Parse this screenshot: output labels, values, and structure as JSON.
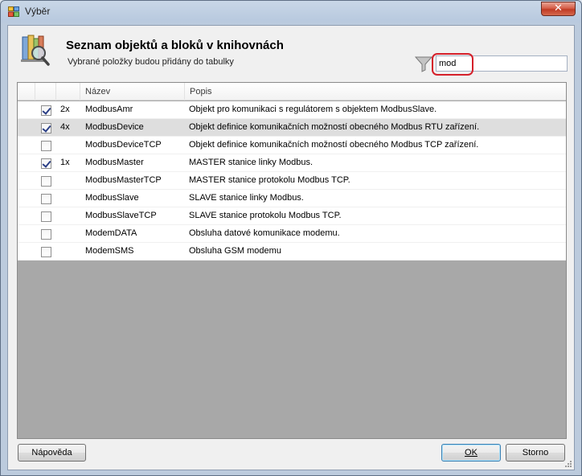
{
  "window": {
    "title": "Výběr",
    "close_glyph": "✕"
  },
  "header": {
    "title": "Seznam objektů a bloků v knihovnách",
    "subtitle": "Vybrané položky budou přidány do tabulky",
    "icon": "library-books-magnifier-icon"
  },
  "search": {
    "value": "mod",
    "placeholder": "",
    "icon": "filter-funnel-icon",
    "highlight_color": "#d5202a"
  },
  "grid": {
    "columns": [
      "",
      "",
      "Název",
      "Popis"
    ],
    "rows": [
      {
        "checked": true,
        "count": "2x",
        "name": "ModbusAmr",
        "desc": "Objekt pro komunikaci s regulátorem s objektem ModbusSlave.",
        "selected": false
      },
      {
        "checked": true,
        "count": "4x",
        "name": "ModbusDevice",
        "desc": "Objekt definice komunikačních možností obecného Modbus RTU zařízení.",
        "selected": true
      },
      {
        "checked": false,
        "count": "",
        "name": "ModbusDeviceTCP",
        "desc": "Objekt definice komunikačních možností obecného Modbus TCP zařízení.",
        "selected": false
      },
      {
        "checked": true,
        "count": "1x",
        "name": "ModbusMaster",
        "desc": "MASTER stanice linky Modbus.",
        "selected": false
      },
      {
        "checked": false,
        "count": "",
        "name": "ModbusMasterTCP",
        "desc": "MASTER stanice protokolu Modbus TCP.",
        "selected": false
      },
      {
        "checked": false,
        "count": "",
        "name": "ModbusSlave",
        "desc": "SLAVE stanice linky Modbus.",
        "selected": false
      },
      {
        "checked": false,
        "count": "",
        "name": "ModbusSlaveTCP",
        "desc": "SLAVE stanice protokolu Modbus TCP.",
        "selected": false
      },
      {
        "checked": false,
        "count": "",
        "name": "ModemDATA",
        "desc": "Obsluha datové komunikace modemu.",
        "selected": false
      },
      {
        "checked": false,
        "count": "",
        "name": "ModemSMS",
        "desc": "Obsluha GSM modemu",
        "selected": false
      }
    ]
  },
  "buttons": {
    "help": "Nápověda",
    "ok": "OK",
    "cancel": "Storno"
  }
}
